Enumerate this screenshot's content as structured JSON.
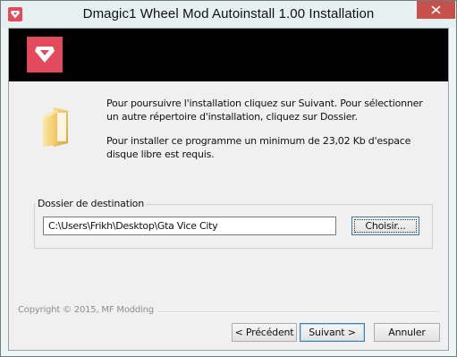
{
  "window": {
    "title": "Dmagic1 Wheel Mod Autoinstall 1.00 Installation",
    "accent_color": "#e34a5c",
    "close_color": "#c7504b"
  },
  "icons": {
    "app": "gem-icon",
    "close": "close-icon",
    "banner_logo": "gem-logo",
    "folder": "folder-icon"
  },
  "intro": {
    "line1": "Pour poursuivre l'installation cliquez sur Suivant. Pour sélectionner un autre répertoire d'installation, cliquez sur Dossier.",
    "line2": "Pour installer ce programme un minimum de 23,02 Kb d'espace disque libre est requis."
  },
  "destination": {
    "label": "Dossier de destination",
    "path": "C:\\Users\\Frikh\\Desktop\\Gta Vice City",
    "browse_label": "Choisir..."
  },
  "footer": {
    "copyright": "Copyright © 2015, MF Modding",
    "back_label": "< Précédent",
    "next_label": "Suivant >",
    "cancel_label": "Annuler"
  }
}
